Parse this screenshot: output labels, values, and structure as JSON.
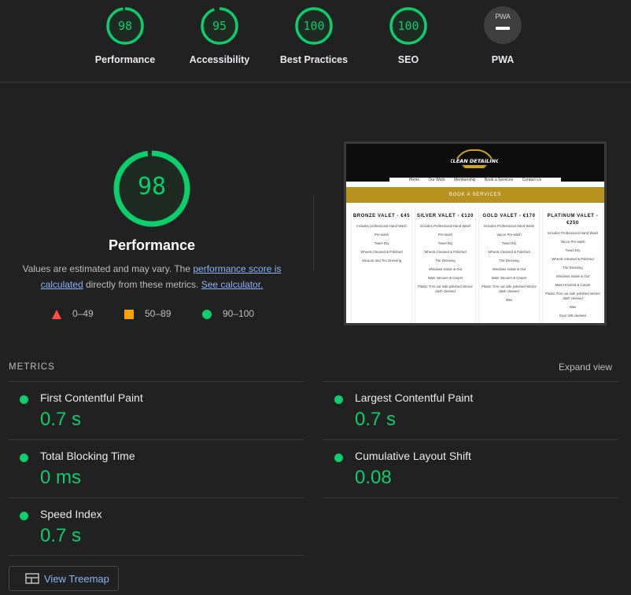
{
  "colors": {
    "pass": "#0cce6b",
    "average": "#ffa400",
    "fail": "#ff4e42",
    "link": "#8ab4f8"
  },
  "categories": [
    {
      "score": "98",
      "score_fraction": 0.98,
      "label": "Performance"
    },
    {
      "score": "95",
      "score_fraction": 0.95,
      "label": "Accessibility"
    },
    {
      "score": "100",
      "score_fraction": 1.0,
      "label": "Best Practices"
    },
    {
      "score": "100",
      "score_fraction": 1.0,
      "label": "SEO"
    },
    {
      "badge": "PWA",
      "label": "PWA"
    }
  ],
  "performance": {
    "score": "98",
    "score_fraction": 0.98,
    "title": "Performance",
    "desc_prefix": "Values are estimated and may vary. The ",
    "desc_link1": "performance score is calculated",
    "desc_mid": " directly from these metrics. ",
    "desc_link2": "See calculator."
  },
  "legend": [
    {
      "shape": "triangle",
      "range": "0–49"
    },
    {
      "shape": "square",
      "range": "50–89"
    },
    {
      "shape": "circle",
      "range": "90–100"
    }
  ],
  "screenshot": {
    "logo_text": "KLEAN DETAILING",
    "nav": [
      "Home",
      "Our Work",
      "Membership",
      "Book a Services",
      "Contact Us"
    ],
    "banner": "BOOK A SERVICES",
    "cards": [
      {
        "title": "BRONZE VALET - €45",
        "items": [
          "Includes professional Hand Wash",
          "Pre-wash",
          "Towel Dry",
          "Wheels Cleaned & Polished",
          "Vacuum and Tire Dressing"
        ]
      },
      {
        "title": "SILVER VALET - €120",
        "items": [
          "Includes Professional Hand Wash",
          "Pre-wash",
          "Towel Dry",
          "Wheels Cleaned & Polished",
          "Tire Dressing",
          "Windows Inside & Out",
          "Mats Vacuum & Carpet",
          "Plastic Trim out side polished interior dash cleaned"
        ]
      },
      {
        "title": "GOLD VALET - €170",
        "items": [
          "Includes Professional Hand Wash",
          "Vacoo Pre-wash",
          "Towel Dry",
          "Wheels Cleaned & Polished",
          "Tire Dressing",
          "Windows Inside & Out",
          "Mats Vacuum & Carpet",
          "Plastic Trim out side polished interior dash cleaned",
          "Wax"
        ]
      },
      {
        "title": "PLATINUM VALET - €250",
        "items": [
          "Includes Professional Hand Wash",
          "Vacoo Pre-wash",
          "Towel Dry",
          "Wheels Cleaned & Polished",
          "Tire Dressing",
          "Windows Inside & Out",
          "Mats Hovered & Carpet",
          "Plastic Trim out side polished interior dash cleaned",
          "Wax",
          "Door sills cleaned"
        ]
      }
    ]
  },
  "metrics_section": {
    "heading": "METRICS",
    "expand_label": "Expand view",
    "items": [
      {
        "title": "First Contentful Paint",
        "value": "0.7 s"
      },
      {
        "title": "Largest Contentful Paint",
        "value": "0.7 s"
      },
      {
        "title": "Total Blocking Time",
        "value": "0 ms"
      },
      {
        "title": "Cumulative Layout Shift",
        "value": "0.08"
      },
      {
        "title": "Speed Index",
        "value": "0.7 s"
      }
    ]
  },
  "treemap_button": {
    "label": "View Treemap"
  }
}
